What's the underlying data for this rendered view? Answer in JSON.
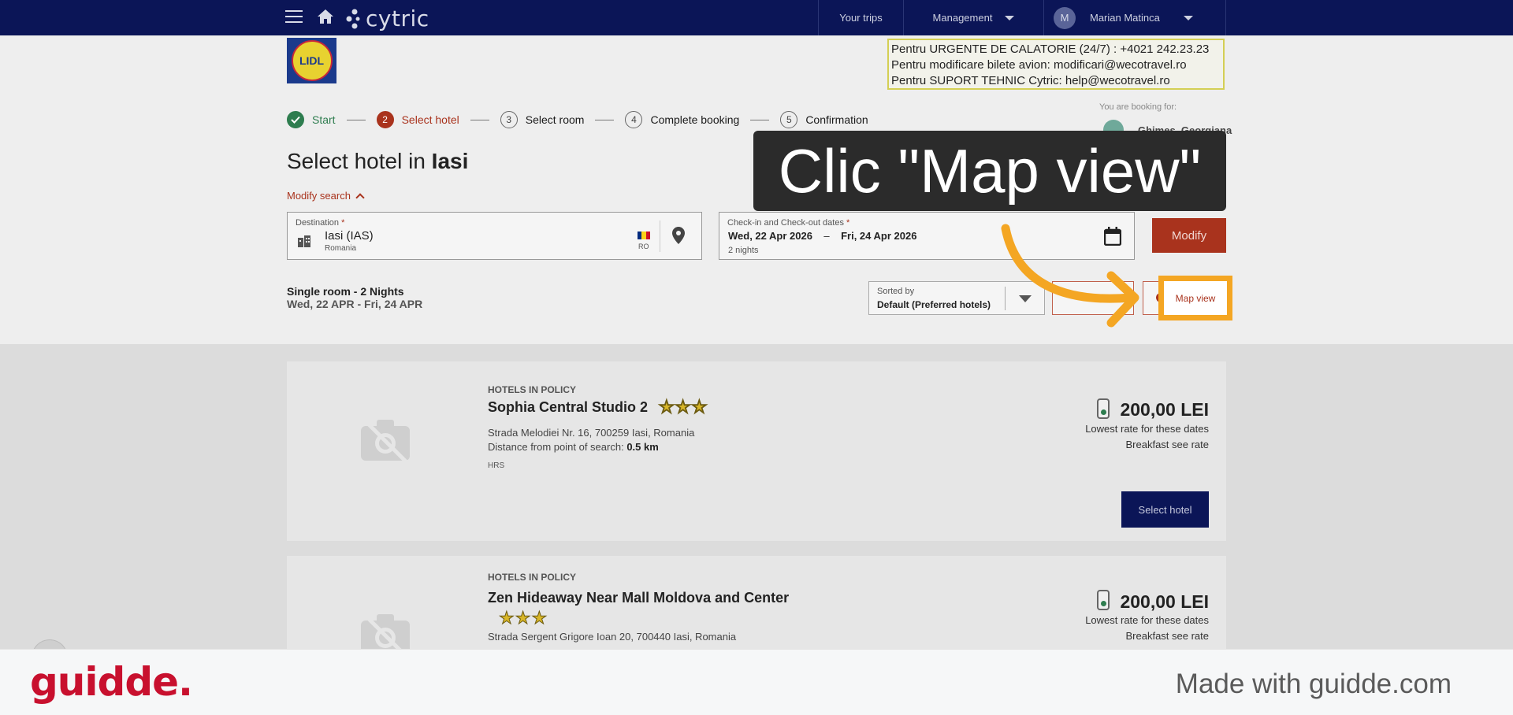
{
  "topbar": {
    "logo": "cytric",
    "your_trips": "Your trips",
    "management": "Management",
    "avatar_initial": "M",
    "user_name": "Marian Matinca"
  },
  "company_logo_text": "LIDL",
  "contact_box": {
    "line1": "Pentru URGENTE DE CALATORIE (24/7) : +4021 242.23.23",
    "line2": "Pentru modificare bilete avion:  modificari@wecotravel.ro",
    "line3": "Pentru SUPORT TEHNIC Cytric:  help@wecotravel.ro"
  },
  "booking_for": {
    "label": "You are booking for:",
    "name": "Ghimes, Georgiana"
  },
  "stepper": [
    {
      "num": "",
      "label": "Start",
      "state": "done"
    },
    {
      "num": "2",
      "label": "Select hotel",
      "state": "active"
    },
    {
      "num": "3",
      "label": "Select room",
      "state": "todo"
    },
    {
      "num": "4",
      "label": "Complete booking",
      "state": "todo"
    },
    {
      "num": "5",
      "label": "Confirmation",
      "state": "todo"
    }
  ],
  "title": {
    "prefix": "Select hotel in ",
    "city": "Iasi"
  },
  "modify_search": "Modify search",
  "destination": {
    "label": "Destination",
    "value": "Iasi (IAS)",
    "country": "Romania",
    "country_code": "RO"
  },
  "dates": {
    "label": "Check-in and Check-out dates",
    "checkin": "Wed, 22 Apr 2026",
    "dash": "–",
    "checkout": "Fri, 24 Apr 2026",
    "nights": "2 nights"
  },
  "modify_button": "Modify",
  "summary": {
    "line1": "Single room - 2 Nights",
    "line2": "Wed, 22 APR - Fri, 24 APR"
  },
  "sort": {
    "label": "Sorted by",
    "value": "Default (Preferred hotels)"
  },
  "map_view_button": "Map view",
  "callout": "Clic \"Map view\"",
  "hotels": [
    {
      "policy": "HOTELS IN POLICY",
      "name": "Sophia Central Studio 2",
      "stars": 3,
      "address": "Strada Melodiei Nr. 16, 700259 Iasi, Romania",
      "distance_label": "Distance from point of search: ",
      "distance": "0.5 km",
      "source": "HRS",
      "price": "200,00 LEI",
      "rate_note": "Lowest rate for these dates",
      "breakfast": "Breakfast see rate",
      "select": "Select hotel"
    },
    {
      "policy": "HOTELS IN POLICY",
      "name": "Zen Hideaway Near Mall Moldova and Center",
      "stars": 3,
      "address": "Strada Sergent Grigore Ioan 20, 700440 Iasi, Romania",
      "price": "200,00 LEI",
      "rate_note": "Lowest rate for these dates",
      "breakfast": "Breakfast see rate"
    }
  ],
  "footer": {
    "brand": "guidde.",
    "made_with": "Made with guidde.com"
  },
  "colors": {
    "navy": "#0b1557",
    "brand_red": "#a9331d",
    "highlight": "#f4a623",
    "guidde_red": "#c8102e"
  }
}
